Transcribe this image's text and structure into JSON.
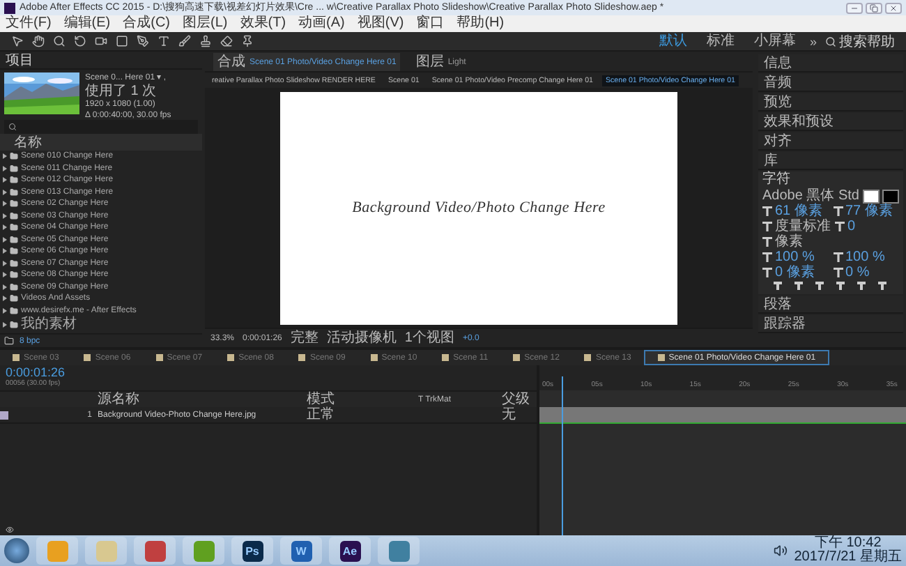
{
  "window": {
    "title": "Adobe After Effects CC 2015 - D:\\搜狗高速下载\\视差幻灯片效果\\Cre ... w\\Creative Parallax Photo Slideshow\\Creative Parallax Photo Slideshow.aep *"
  },
  "menu": [
    "文件(F)",
    "编辑(E)",
    "合成(C)",
    "图层(L)",
    "效果(T)",
    "动画(A)",
    "视图(V)",
    "窗口",
    "帮助(H)"
  ],
  "workspaces": [
    {
      "label": "默认",
      "selected": true
    },
    {
      "label": "标准",
      "selected": false
    },
    {
      "label": "小屏幕",
      "selected": false
    }
  ],
  "more": "»",
  "help_search": {
    "placeholder": "搜索帮助"
  },
  "project": {
    "title": "项目",
    "item_name": "Scene 0... Here 01 ▾ ,",
    "usage": "使用了 1 次",
    "size": "1920 x 1080 (1.00)",
    "duration": "Δ 0:00:40:00, 30.00 fps",
    "column": "名称",
    "items": [
      {
        "label": "Scene 010 Change Here"
      },
      {
        "label": "Scene 011 Change Here"
      },
      {
        "label": "Scene 012 Change Here"
      },
      {
        "label": "Scene 013 Change Here"
      },
      {
        "label": "Scene 02 Change Here"
      },
      {
        "label": "Scene 03 Change Here"
      },
      {
        "label": "Scene 04 Change Here"
      },
      {
        "label": "Scene 05 Change Here"
      },
      {
        "label": "Scene 06 Change Here"
      },
      {
        "label": "Scene 07 Change Here"
      },
      {
        "label": "Scene 08 Change Here"
      },
      {
        "label": "Scene 09 Change Here"
      },
      {
        "label": "Videos And Assets"
      },
      {
        "label": "www.desirefx.me - After Effects"
      },
      {
        "label": "我的素材"
      }
    ],
    "bpc": "8 bpc"
  },
  "viewer": {
    "tabs": [
      {
        "prefix": "合成",
        "label": "Scene 01 Photo/Video Change Here 01",
        "selected": true
      },
      {
        "prefix": "图层",
        "label": "Light",
        "selected": false
      }
    ],
    "breadcrumbs": [
      {
        "label": "reative Parallax Photo Slideshow RENDER HERE",
        "selected": false
      },
      {
        "label": "Scene 01",
        "selected": false
      },
      {
        "label": "Scene 01 Photo/Video Precomp Change Here 01",
        "selected": false
      },
      {
        "label": "Scene 01 Photo/Video Change Here 01",
        "selected": true
      }
    ],
    "canvas_text": "Background Video/Photo Change Here",
    "zoom": "33.3%",
    "timecode": "0:00:01:26",
    "resolution": "完整",
    "camera": "活动摄像机",
    "views": "1个视图",
    "exposure": "+0.0"
  },
  "panels": [
    {
      "label": "信息"
    },
    {
      "label": "音频"
    },
    {
      "label": "预览"
    },
    {
      "label": "效果和预设"
    },
    {
      "label": "对齐"
    },
    {
      "label": "库"
    }
  ],
  "character": {
    "title": "字符",
    "font": "Adobe 黑体 Std",
    "size": "61 像素",
    "leading": "77 像素",
    "kerning": "度量标准",
    "tracking": "0",
    "unit": "像素",
    "vscale": "100 %",
    "hscale": "100 %",
    "baseline": "0 像素",
    "tsume": "0 %"
  },
  "panels_after": [
    {
      "label": "段落"
    },
    {
      "label": "跟踪器"
    }
  ],
  "timeline": {
    "tabs": [
      {
        "label": "Scene 03",
        "selected": false
      },
      {
        "label": "Scene 06",
        "selected": false
      },
      {
        "label": "Scene 07",
        "selected": false
      },
      {
        "label": "Scene 08",
        "selected": false
      },
      {
        "label": "Scene 09",
        "selected": false
      },
      {
        "label": "Scene 10",
        "selected": false
      },
      {
        "label": "Scene 11",
        "selected": false
      },
      {
        "label": "Scene 12",
        "selected": false
      },
      {
        "label": "Scene 13",
        "selected": false
      },
      {
        "label": "Scene 01 Photo/Video Change Here 01",
        "selected": true
      }
    ],
    "timecode": "0:00:01:26",
    "frame": "00056 (30.00 fps)",
    "columns": [
      "源名称",
      "模式",
      "T TrkMat",
      "父级"
    ],
    "layers": [
      {
        "number": "1",
        "name": "Background Video-Photo Change Here.jpg",
        "mode": "正常",
        "parent": "无"
      }
    ],
    "ruler": [
      "00s",
      "05s",
      "10s",
      "15s",
      "20s",
      "25s",
      "30s",
      "35s"
    ]
  },
  "taskbar": {
    "apps": [
      {
        "kind": "start"
      },
      {
        "kind": "app",
        "color": "#e8a020"
      },
      {
        "kind": "app",
        "color": "#d8c890"
      },
      {
        "kind": "app",
        "color": "#c04040"
      },
      {
        "kind": "app",
        "color": "#60a020"
      },
      {
        "kind": "app",
        "label": "Ps",
        "color": "#0a2a4a"
      },
      {
        "kind": "app",
        "label": "W",
        "color": "#2060b0"
      },
      {
        "kind": "app",
        "label": "Ae",
        "color": "#2a1050"
      },
      {
        "kind": "app",
        "color": "#4080a0"
      }
    ],
    "time": "下午 10:42",
    "date": "2017/7/21 星期五"
  }
}
